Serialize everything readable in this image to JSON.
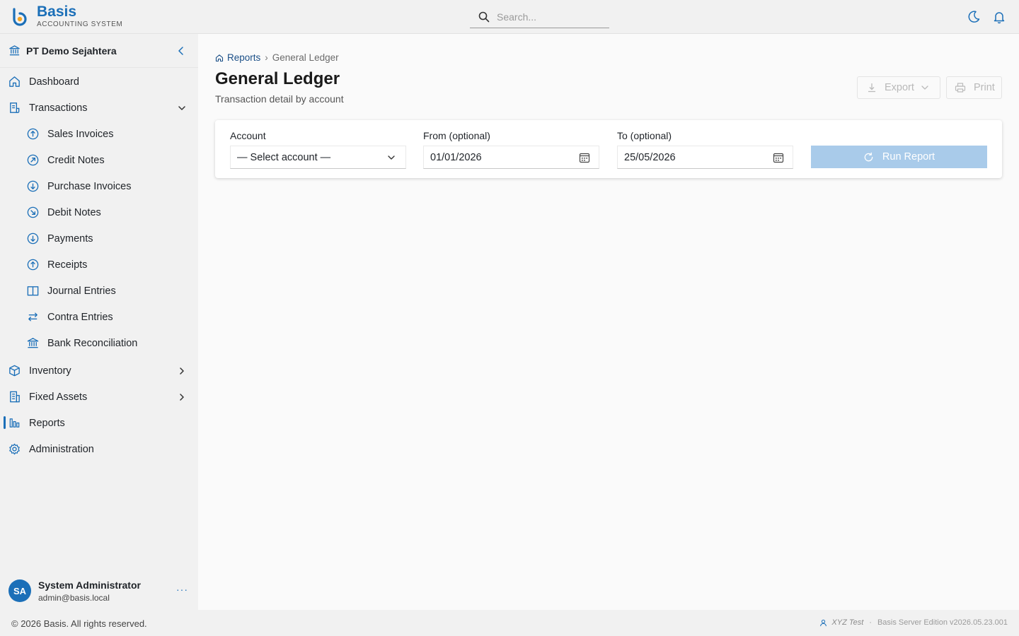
{
  "app": {
    "brand_name": "Basis",
    "brand_subtitle": "ACCOUNTING SYSTEM",
    "accent_color": "#1b6fb8"
  },
  "search": {
    "placeholder": "Search..."
  },
  "topbar_icons": [
    "moon-icon",
    "bell-icon"
  ],
  "sidebar": {
    "organization": "PT Demo Sejahtera",
    "items": [
      {
        "label": "Dashboard",
        "icon": "home-icon"
      },
      {
        "label": "Transactions",
        "icon": "document-icon",
        "expanded": true
      },
      {
        "label": "Sales Invoices",
        "icon": "arrow-up-circle-icon"
      },
      {
        "label": "Credit Notes",
        "icon": "arrow-up-right-circle-icon"
      },
      {
        "label": "Purchase Invoices",
        "icon": "arrow-down-circle-icon"
      },
      {
        "label": "Debit Notes",
        "icon": "arrow-down-right-circle-icon"
      },
      {
        "label": "Payments",
        "icon": "arrow-down-circle-icon"
      },
      {
        "label": "Receipts",
        "icon": "arrow-up-circle-icon"
      },
      {
        "label": "Journal Entries",
        "icon": "book-icon"
      },
      {
        "label": "Contra Entries",
        "icon": "swap-arrows-icon"
      },
      {
        "label": "Bank Reconciliation",
        "icon": "bank-icon"
      },
      {
        "label": "Inventory",
        "icon": "box-icon"
      },
      {
        "label": "Fixed Assets",
        "icon": "building-icon"
      },
      {
        "label": "Reports",
        "icon": "bar-chart-icon",
        "active": true
      },
      {
        "label": "Administration",
        "icon": "gear-icon"
      }
    ]
  },
  "user": {
    "initials": "SA",
    "name": "System Administrator",
    "email": "admin@basis.local",
    "more": "···"
  },
  "breadcrumb": {
    "parent": "Reports",
    "separator": "›",
    "current": "General Ledger"
  },
  "page": {
    "title": "General Ledger",
    "subtitle": "Transaction detail by account"
  },
  "toolbar": {
    "export_label": "Export",
    "print_label": "Print"
  },
  "filters": {
    "account_label": "Account",
    "account_value": "— Select account —",
    "from_label": "From (optional)",
    "from_value": "01/01/2026",
    "to_label": "To (optional)",
    "to_value": "25/05/2026",
    "run_label": "Run Report"
  },
  "footer": {
    "copyright": "© 2026 Basis. All rights reserved.",
    "tenant": "XYZ Test",
    "separator": "·",
    "version": "Basis Server Edition v2026.05.23.001"
  }
}
